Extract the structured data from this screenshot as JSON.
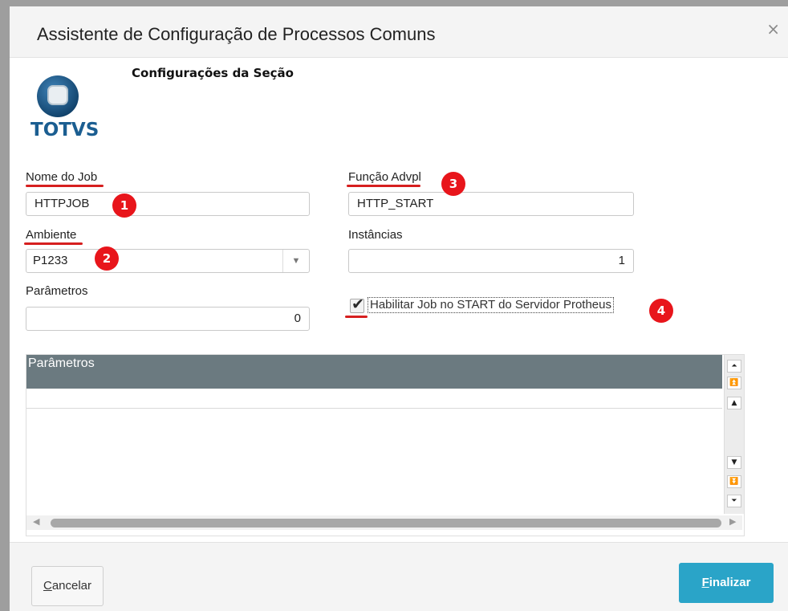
{
  "dialog": {
    "title": "Assistente de Configuração de Processos Comuns",
    "close_icon": "×"
  },
  "section": {
    "title": "Configurações da Seção",
    "logo_text": "TOTVS"
  },
  "fields": {
    "nome_do_job": {
      "label": "Nome do Job",
      "value": "HTTPJOB"
    },
    "funcao_advpl": {
      "label": "Função Advpl",
      "value": "HTTP_START"
    },
    "ambiente": {
      "label": "Ambiente",
      "value": "P1233"
    },
    "instancias": {
      "label": "Instâncias",
      "value": "1"
    },
    "parametros": {
      "label": "Parâmetros",
      "value": "0"
    },
    "habilitar_job": {
      "label": "Habilitar Job no START do Servidor Protheus",
      "checked": true
    }
  },
  "annotations": [
    "1",
    "2",
    "3",
    "4"
  ],
  "grid": {
    "header": "Parâmetros"
  },
  "footer": {
    "cancel_first": "C",
    "cancel_rest": "ancelar",
    "finish_first": "F",
    "finish_rest": "inalizar"
  },
  "colors": {
    "annotation_red": "#e8151b",
    "grid_header": "#6b7a80",
    "primary_button": "#2aa4c8",
    "logo_blue": "#1b5e91"
  }
}
